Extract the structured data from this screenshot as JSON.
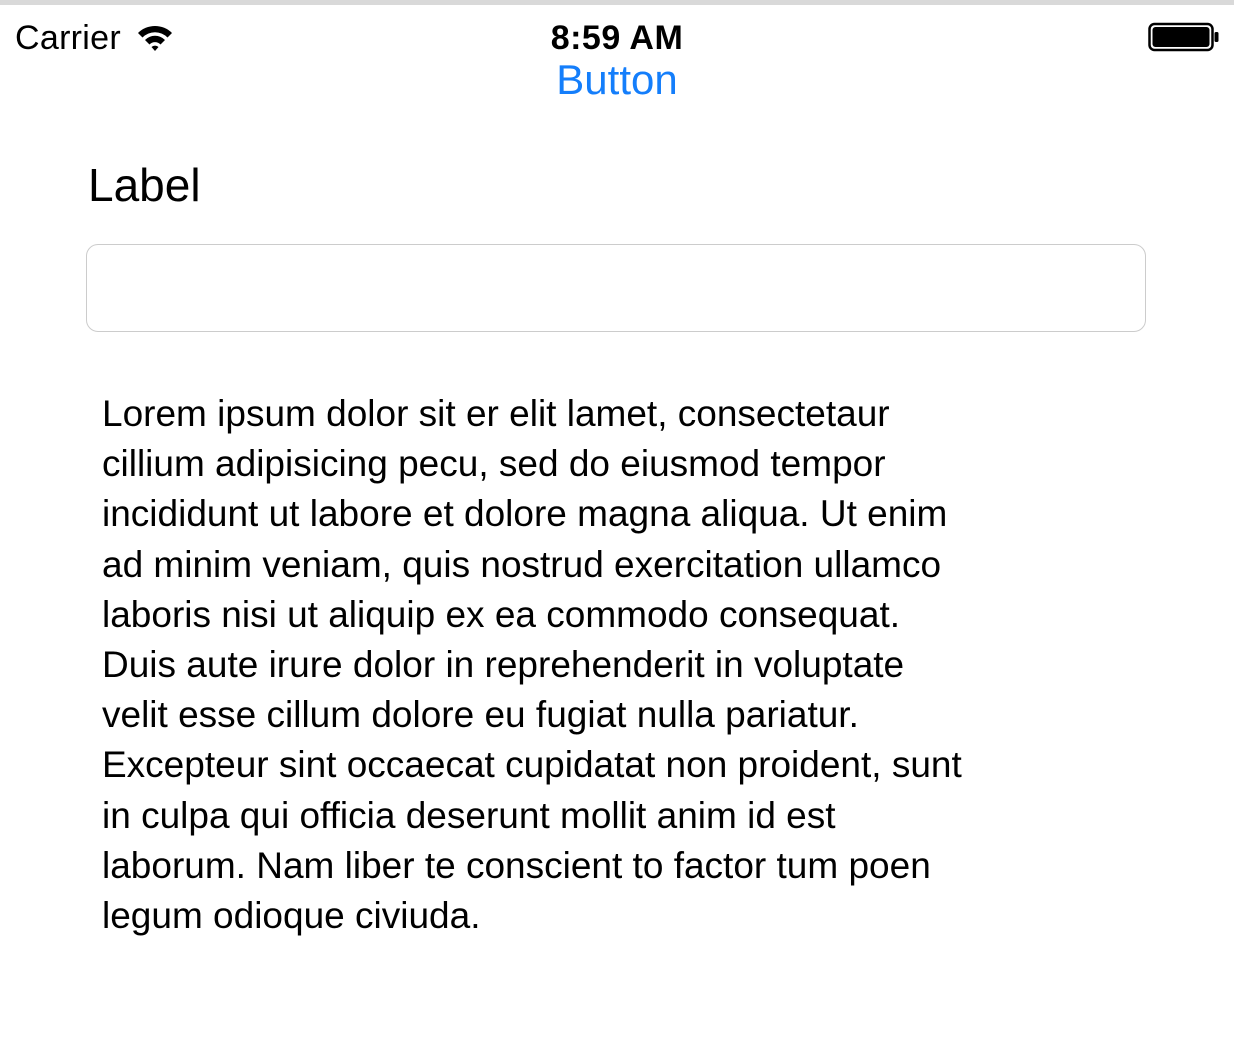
{
  "status_bar": {
    "carrier": "Carrier",
    "time": "8:59 AM",
    "wifi_icon": "wifi-icon",
    "battery_icon": "battery-icon"
  },
  "top_button": {
    "label": "Button",
    "color": "#147efb"
  },
  "main": {
    "label": "Label",
    "text_field": {
      "value": "",
      "placeholder": ""
    },
    "body_text": "Lorem ipsum dolor sit er elit lamet, consectetaur\ncillium adipisicing pecu, sed do eiusmod tempor\nincididunt ut labore et dolore magna aliqua. Ut enim\nad minim veniam, quis nostrud exercitation ullamco\nlaboris nisi ut aliquip ex ea commodo consequat.\nDuis aute irure dolor in reprehenderit in voluptate\nvelit esse cillum dolore eu fugiat nulla pariatur.\nExcepteur sint occaecat cupidatat non proident, sunt\nin culpa qui officia deserunt mollit anim id est\nlaborum. Nam liber te conscient to factor tum poen\nlegum odioque civiuda."
  }
}
